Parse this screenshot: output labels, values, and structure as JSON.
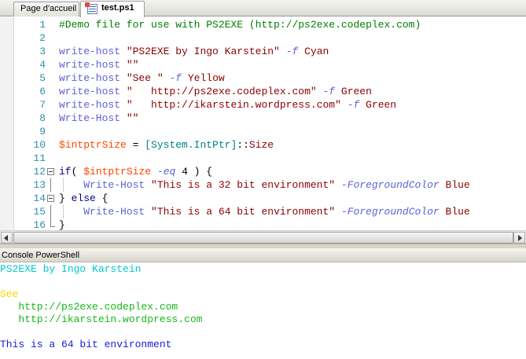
{
  "tabs": [
    {
      "label": "Page d'accueil",
      "active": false
    },
    {
      "label": "test.ps1",
      "active": true
    }
  ],
  "editor": {
    "lines": [
      {
        "num": "1",
        "tokens": [
          {
            "t": "#Demo file for use with PS2EXE (http://ps2exe.codeplex.com)",
            "c": "comment"
          }
        ]
      },
      {
        "num": "2",
        "tokens": []
      },
      {
        "num": "3",
        "tokens": [
          {
            "t": "write-host",
            "c": "cmd"
          },
          {
            "t": " ",
            "c": "op"
          },
          {
            "t": "\"PS2EXE by Ingo Karstein\"",
            "c": "str"
          },
          {
            "t": " ",
            "c": "op"
          },
          {
            "t": "-f",
            "c": "param"
          },
          {
            "t": " Cyan",
            "c": "value"
          }
        ]
      },
      {
        "num": "4",
        "tokens": [
          {
            "t": "write-host",
            "c": "cmd"
          },
          {
            "t": " ",
            "c": "op"
          },
          {
            "t": "\"\"",
            "c": "str"
          }
        ]
      },
      {
        "num": "5",
        "tokens": [
          {
            "t": "write-host",
            "c": "cmd"
          },
          {
            "t": " ",
            "c": "op"
          },
          {
            "t": "\"See \"",
            "c": "str"
          },
          {
            "t": " ",
            "c": "op"
          },
          {
            "t": "-f",
            "c": "param"
          },
          {
            "t": " Yellow",
            "c": "value"
          }
        ]
      },
      {
        "num": "6",
        "tokens": [
          {
            "t": "write-host",
            "c": "cmd"
          },
          {
            "t": " ",
            "c": "op"
          },
          {
            "t": "\"   http://ps2exe.codeplex.com\"",
            "c": "str"
          },
          {
            "t": " ",
            "c": "op"
          },
          {
            "t": "-f",
            "c": "param"
          },
          {
            "t": " Green",
            "c": "value"
          }
        ]
      },
      {
        "num": "7",
        "tokens": [
          {
            "t": "write-host",
            "c": "cmd"
          },
          {
            "t": " ",
            "c": "op"
          },
          {
            "t": "\"   http://ikarstein.wordpress.com\"",
            "c": "str"
          },
          {
            "t": " ",
            "c": "op"
          },
          {
            "t": "-f",
            "c": "param"
          },
          {
            "t": " Green",
            "c": "value"
          }
        ]
      },
      {
        "num": "8",
        "tokens": [
          {
            "t": "Write-Host",
            "c": "cmd"
          },
          {
            "t": " ",
            "c": "op"
          },
          {
            "t": "\"\"",
            "c": "str"
          }
        ]
      },
      {
        "num": "9",
        "tokens": []
      },
      {
        "num": "10",
        "tokens": [
          {
            "t": "$intptrSize",
            "c": "var"
          },
          {
            "t": " = ",
            "c": "op"
          },
          {
            "t": "[System.IntPtr]",
            "c": "type"
          },
          {
            "t": "::",
            "c": "op"
          },
          {
            "t": "Size",
            "c": "member"
          }
        ]
      },
      {
        "num": "11",
        "tokens": []
      },
      {
        "num": "12",
        "fold": "start",
        "tokens": [
          {
            "t": "if",
            "c": "kw"
          },
          {
            "t": "( ",
            "c": "op"
          },
          {
            "t": "$intptrSize",
            "c": "var"
          },
          {
            "t": " ",
            "c": "op"
          },
          {
            "t": "-eq",
            "c": "param"
          },
          {
            "t": " 4 ) {",
            "c": "op"
          }
        ]
      },
      {
        "num": "13",
        "indent": true,
        "tokens": [
          {
            "t": "    ",
            "c": "op"
          },
          {
            "t": "Write-Host",
            "c": "cmd"
          },
          {
            "t": " ",
            "c": "op"
          },
          {
            "t": "\"This is a 32 bit environment\"",
            "c": "str"
          },
          {
            "t": " ",
            "c": "op"
          },
          {
            "t": "-ForegroundColor",
            "c": "param"
          },
          {
            "t": " Blue",
            "c": "value"
          }
        ]
      },
      {
        "num": "14",
        "fold": "start",
        "tokens": [
          {
            "t": "} ",
            "c": "op"
          },
          {
            "t": "else",
            "c": "kw"
          },
          {
            "t": " {",
            "c": "op"
          }
        ]
      },
      {
        "num": "15",
        "indent": true,
        "tokens": [
          {
            "t": "    ",
            "c": "op"
          },
          {
            "t": "Write-Host",
            "c": "cmd"
          },
          {
            "t": " ",
            "c": "op"
          },
          {
            "t": "\"This is a 64 bit environment\"",
            "c": "str"
          },
          {
            "t": " ",
            "c": "op"
          },
          {
            "t": "-ForegroundColor",
            "c": "param"
          },
          {
            "t": " Blue",
            "c": "value"
          }
        ]
      },
      {
        "num": "16",
        "fold": "end",
        "tokens": [
          {
            "t": "}",
            "c": "op"
          }
        ]
      }
    ]
  },
  "console": {
    "title": "Console PowerShell",
    "lines": [
      {
        "text": "PS2EXE by Ingo Karstein",
        "color": "cyan"
      },
      {
        "text": "",
        "color": "cyan"
      },
      {
        "text": "See",
        "color": "yellow"
      },
      {
        "text": "   http://ps2exe.codeplex.com",
        "color": "green"
      },
      {
        "text": "   http://ikarstein.wordpress.com",
        "color": "green"
      },
      {
        "text": "",
        "color": "cyan"
      },
      {
        "text": "This is a 64 bit environment",
        "color": "blue"
      }
    ]
  },
  "colors": {
    "cyan": "#00c8d2",
    "yellow": "#ffd400",
    "green": "#18b818",
    "blue": "#1a1ad8"
  },
  "icons": {
    "script_tab": "script-file-icon"
  }
}
